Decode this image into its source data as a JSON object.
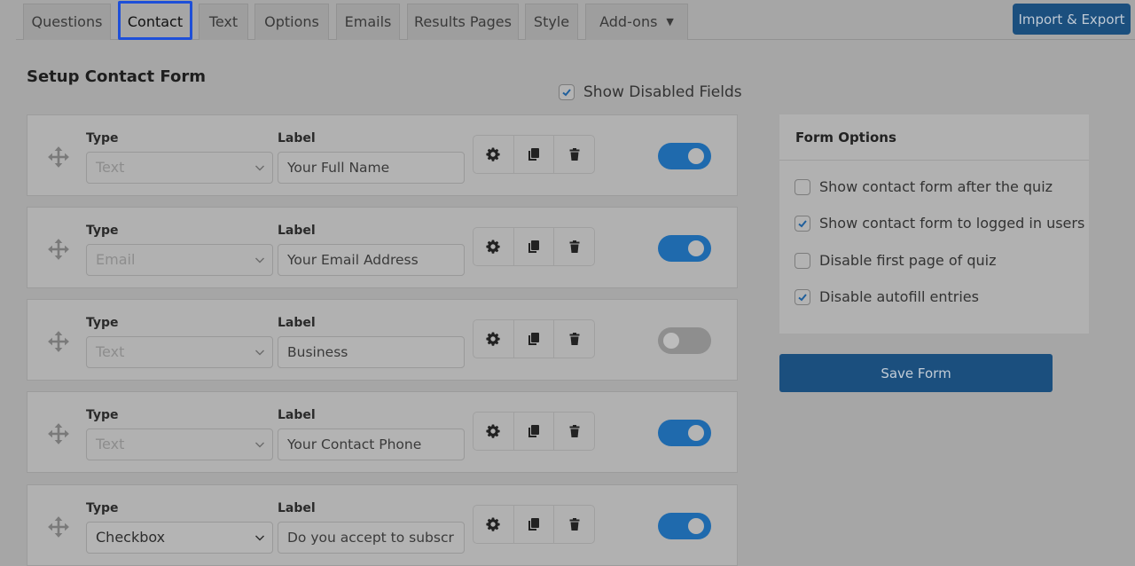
{
  "tabs": [
    {
      "label": "Questions",
      "active": false
    },
    {
      "label": "Contact",
      "active": true
    },
    {
      "label": "Text",
      "active": false
    },
    {
      "label": "Options",
      "active": false
    },
    {
      "label": "Emails",
      "active": false
    },
    {
      "label": "Results Pages",
      "active": false
    },
    {
      "label": "Style",
      "active": false
    },
    {
      "label": "Add-ons",
      "active": false,
      "caret": "▼"
    }
  ],
  "import_export_label": "Import & Export",
  "page_title": "Setup Contact Form",
  "show_disabled": {
    "label": "Show Disabled Fields",
    "checked": true
  },
  "field_headers": {
    "type": "Type",
    "label": "Label"
  },
  "fields": [
    {
      "type": "Text",
      "type_disabled": true,
      "label": "Your Full Name",
      "enabled": true
    },
    {
      "type": "Email",
      "type_disabled": true,
      "label": "Your Email Address",
      "enabled": true
    },
    {
      "type": "Text",
      "type_disabled": true,
      "label": "Business",
      "enabled": false
    },
    {
      "type": "Text",
      "type_disabled": true,
      "label": "Your Contact Phone",
      "enabled": true
    },
    {
      "type": "Checkbox",
      "type_disabled": false,
      "label": "Do you accept to subscribe",
      "enabled": true
    }
  ],
  "actions": [
    {
      "name": "settings",
      "icon": "gear-icon"
    },
    {
      "name": "duplicate",
      "icon": "copy-icon"
    },
    {
      "name": "delete",
      "icon": "trash-icon"
    }
  ],
  "form_options": {
    "title": "Form Options",
    "items": [
      {
        "label": "Show contact form after the quiz",
        "checked": false
      },
      {
        "label": "Show contact form to logged in users",
        "checked": true
      },
      {
        "label": "Disable first page of quiz",
        "checked": false
      },
      {
        "label": "Disable autofill entries",
        "checked": true
      }
    ]
  },
  "save_label": "Save Form",
  "colors": {
    "primary": "#1b4f7e",
    "toggle_on": "#1f6aad",
    "active_tab_outline": "#1e4fd8"
  }
}
